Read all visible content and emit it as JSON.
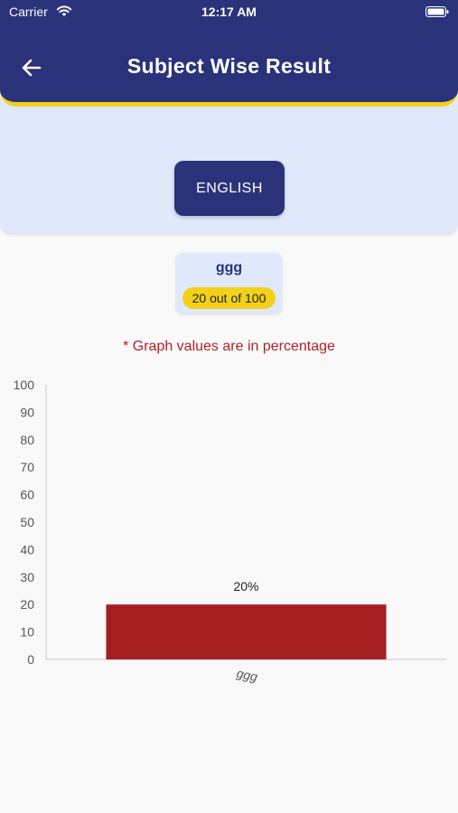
{
  "status_bar": {
    "carrier": "Carrier",
    "time": "12:17 AM"
  },
  "header": {
    "title": "Subject Wise Result",
    "back_icon": "back-arrow-icon"
  },
  "subject": {
    "label": "ENGLISH"
  },
  "score_card": {
    "name": "ggg",
    "score_text": "20 out of 100"
  },
  "note": "* Graph values are in percentage",
  "colors": {
    "primary": "#2a337a",
    "accent": "#f2d11b",
    "bar": "#a51f22",
    "panel": "#dfe9fb"
  },
  "chart_data": {
    "type": "bar",
    "categories": [
      "ggg"
    ],
    "values": [
      20
    ],
    "value_labels": [
      "20%"
    ],
    "ylim": [
      0,
      100
    ],
    "yticks": [
      "0",
      "10",
      "20",
      "30",
      "40",
      "50",
      "60",
      "70",
      "80",
      "90",
      "100"
    ],
    "grid": false
  }
}
